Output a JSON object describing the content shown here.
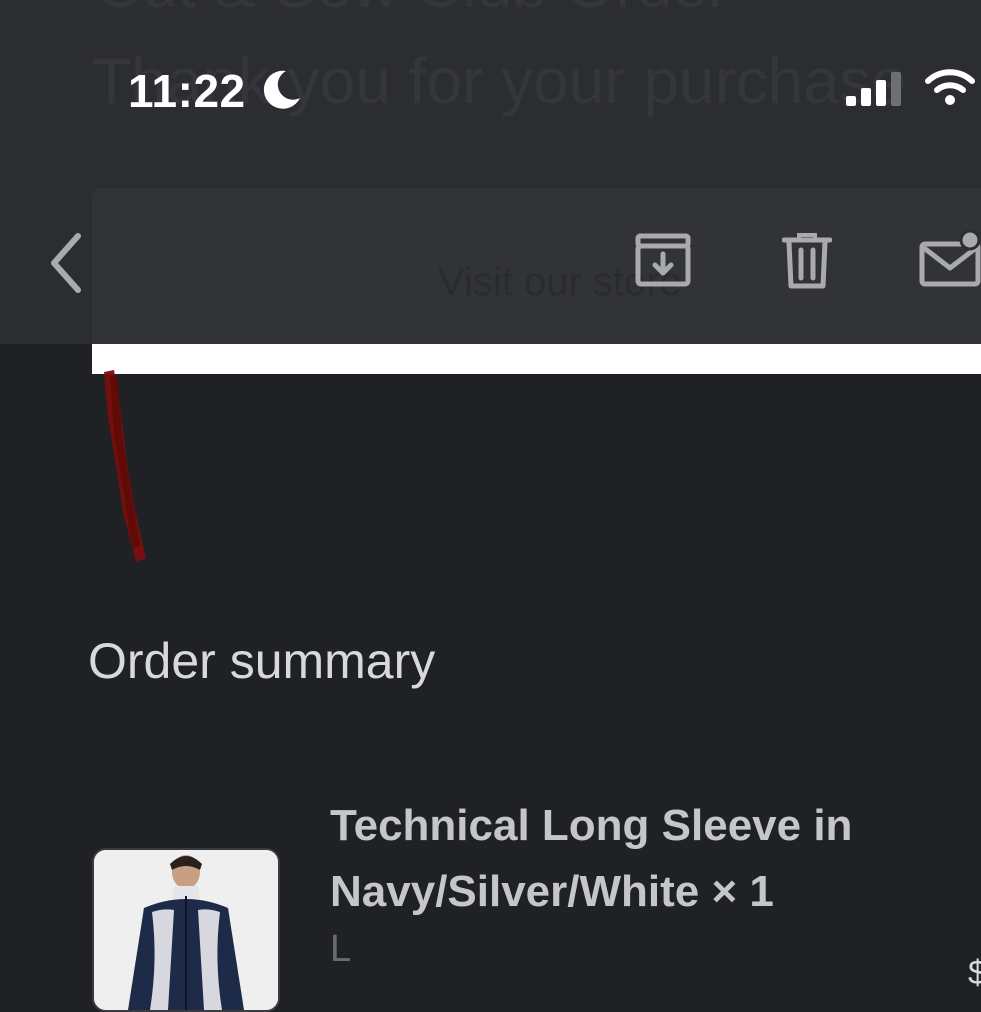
{
  "status_bar": {
    "time": "11:22",
    "icons": [
      "moon-icon",
      "signal-icon",
      "wifi-icon"
    ]
  },
  "email_header": {
    "ghost_heading_top": "Cut & Sew Club Order",
    "ghost_heading": "Thank you for your purchase",
    "ghost_store_link": "Visit our store"
  },
  "toolbar": {
    "icons": [
      "back-chevron-icon",
      "archive-icon",
      "trash-icon",
      "mark-unread-icon"
    ]
  },
  "order": {
    "section_title": "Order summary",
    "items": [
      {
        "title": "Technical Long Sleeve in Navy/Silver/White × 1",
        "variant": "L"
      }
    ],
    "edge_glyph": "$"
  },
  "colors": {
    "background": "#202125",
    "header": "#2c2d31",
    "card": "#323337",
    "text_primary": "#d8d9dc",
    "text_muted": "#6b6c70",
    "icon_gray": "#a9aaad",
    "redaction": "#7a0f0c"
  }
}
